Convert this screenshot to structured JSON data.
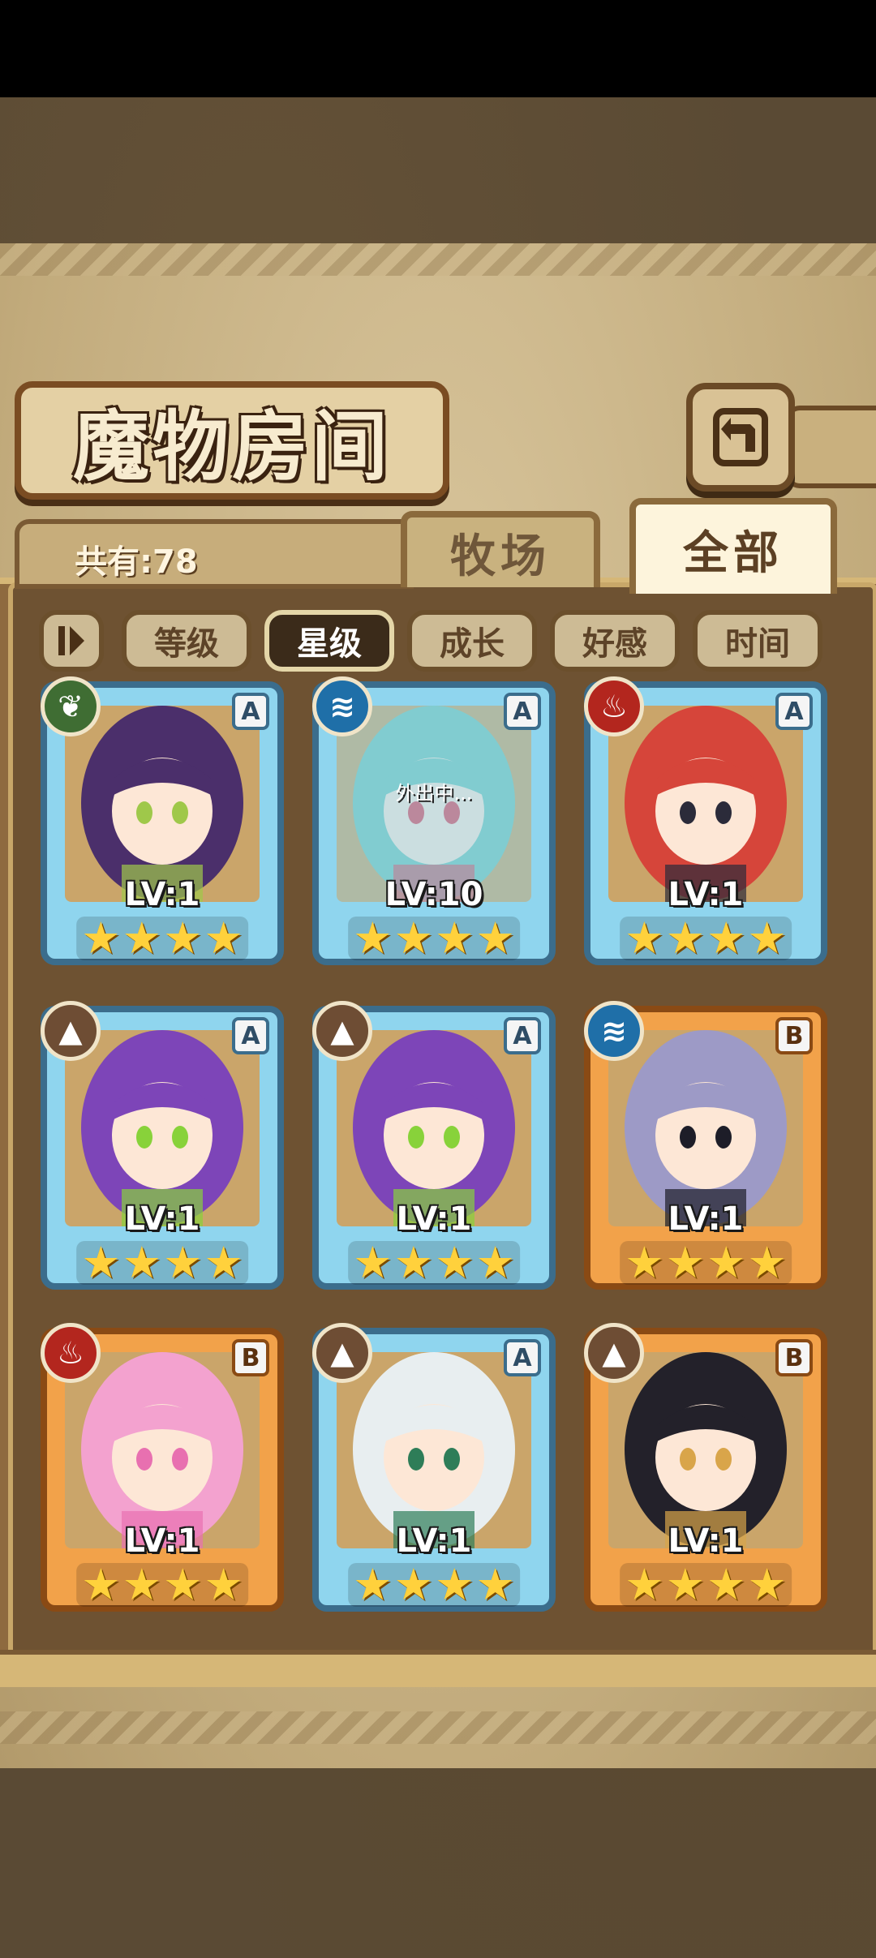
{
  "header": {
    "title": "魔物房间",
    "total_count": "共有:78"
  },
  "tabs": [
    {
      "label": "牧场",
      "active": false
    },
    {
      "label": "全部",
      "active": true
    }
  ],
  "sort": {
    "options": [
      "等级",
      "星级",
      "成长",
      "好感",
      "时间"
    ],
    "active": "星级"
  },
  "icons": {
    "back": "back-arrow-icon",
    "sort_order": "sort-order-icon"
  },
  "monsters": [
    {
      "element": "leaf",
      "rank": "A",
      "level": "LV:1",
      "stars": 4,
      "status": "",
      "hair": "#4b2f6b",
      "accent": "#9fc84a"
    },
    {
      "element": "water",
      "rank": "A",
      "level": "LV:10",
      "stars": 4,
      "status": "外出中...",
      "hair": "#76c5b8",
      "accent": "#e04a5a"
    },
    {
      "element": "fire",
      "rank": "A",
      "level": "LV:1",
      "stars": 4,
      "status": "",
      "hair": "#d6453a",
      "accent": "#2b2b3a"
    },
    {
      "element": "earth",
      "rank": "A",
      "level": "LV:1",
      "stars": 4,
      "status": "",
      "hair": "#7d45b8",
      "accent": "#88d23a"
    },
    {
      "element": "earth",
      "rank": "A",
      "level": "LV:1",
      "stars": 4,
      "status": "",
      "hair": "#7d45b8",
      "accent": "#88d23a"
    },
    {
      "element": "water",
      "rank": "B",
      "level": "LV:1",
      "stars": 4,
      "status": "",
      "hair": "#9d9ac6",
      "accent": "#1d1d28"
    },
    {
      "element": "fire",
      "rank": "B",
      "level": "LV:1",
      "stars": 4,
      "status": "",
      "hair": "#f3a2cf",
      "accent": "#e870b0"
    },
    {
      "element": "earth",
      "rank": "A",
      "level": "LV:1",
      "stars": 4,
      "status": "",
      "hair": "#e8eef0",
      "accent": "#2e7d58"
    },
    {
      "element": "earth",
      "rank": "B",
      "level": "LV:1",
      "stars": 4,
      "status": "",
      "hair": "#23212a",
      "accent": "#d9a54a"
    }
  ],
  "colors": {
    "rank_a": "#8fd5ee",
    "rank_b": "#f2a24a",
    "star": "#ffd13c"
  }
}
